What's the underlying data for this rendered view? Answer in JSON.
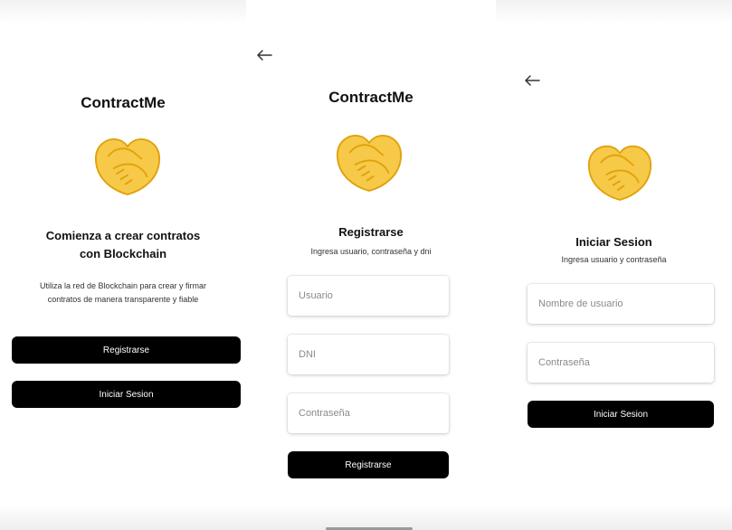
{
  "colors": {
    "button_bg": "#000000",
    "button_text": "#ffffff",
    "logo_yellow": "#f7c948",
    "logo_outline": "#e0a20c",
    "placeholder": "#8a8a8a"
  },
  "screens": [
    {
      "app_title": "ContractMe",
      "logo_icon": "handshake-icon",
      "heading_line1": "Comienza a crear contratos",
      "heading_line2": "con Blockchain",
      "description_line1": "Utiliza la red de Blockchain para crear y firmar",
      "description_line2": "contratos de manera transparente y fiable",
      "register_label": "Registrarse",
      "login_label": "Iniciar Sesion"
    },
    {
      "back_icon": "arrow-left-icon",
      "app_title": "ContractMe",
      "logo_icon": "handshake-icon",
      "heading": "Registrarse",
      "hint": "Ingresa usuario, contraseña y dni",
      "fields": [
        {
          "placeholder": "Usuario"
        },
        {
          "placeholder": "DNI"
        },
        {
          "placeholder": "Contraseña"
        }
      ],
      "submit_label": "Registrarse"
    },
    {
      "back_icon": "arrow-left-icon",
      "logo_icon": "handshake-icon",
      "heading": "Iniciar Sesion",
      "hint": "Ingresa usuario y contraseña",
      "fields": [
        {
          "placeholder": "Nombre de usuario"
        },
        {
          "placeholder": "Contraseña"
        }
      ],
      "submit_label": "Iniciar Sesion"
    }
  ]
}
